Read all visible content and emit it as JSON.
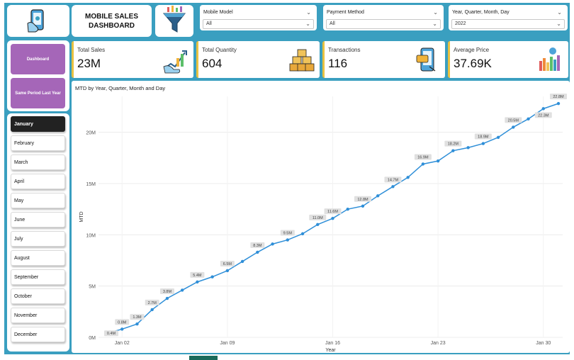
{
  "header": {
    "title": "MOBILE SALES DASHBOARD",
    "slicers": [
      {
        "label": "Mobile Model",
        "value": "All"
      },
      {
        "label": "Payment Method",
        "value": "All"
      },
      {
        "label": "Year, Quarter, Month, Day",
        "value": "2022"
      }
    ]
  },
  "kpis": [
    {
      "label": "Total Sales",
      "value": "23M",
      "icon": "sales-growth-icon"
    },
    {
      "label": "Total Quantity",
      "value": "604",
      "icon": "boxes-icon"
    },
    {
      "label": "Transactions",
      "value": "116",
      "icon": "phone-transaction-icon"
    },
    {
      "label": "Average Price",
      "value": "37.69K",
      "icon": "bar-chart-icon"
    }
  ],
  "nav": {
    "dashboard": "Dashboard",
    "same_period": "Same Period Last Year"
  },
  "months": [
    "January",
    "February",
    "March",
    "April",
    "May",
    "June",
    "July",
    "August",
    "September",
    "October",
    "November",
    "December"
  ],
  "active_month": "January",
  "colors": {
    "accent": "#3a9fc0",
    "nav": "#a566b8",
    "line": "#2f8fd8",
    "kpi_bar": "#e8c140"
  },
  "chart_data": {
    "type": "line",
    "title": "MTD by Year, Quarter, Month and Day",
    "xlabel": "Year",
    "ylabel": "MTD",
    "ylim": [
      0,
      23.5
    ],
    "yticks": [
      "0M",
      "5M",
      "10M",
      "15M",
      "20M"
    ],
    "xticks": [
      {
        "day": 2,
        "label": "Jan 02"
      },
      {
        "day": 9,
        "label": "Jan 09"
      },
      {
        "day": 16,
        "label": "Jan 16"
      },
      {
        "day": 23,
        "label": "Jan 23"
      },
      {
        "day": 30,
        "label": "Jan 30"
      }
    ],
    "series": [
      {
        "x": [
          1,
          2,
          3,
          4,
          5,
          6,
          7,
          8,
          9,
          10,
          11,
          12,
          13,
          14,
          15,
          16,
          17,
          18,
          19,
          20,
          21,
          22,
          23,
          24,
          25,
          26,
          27,
          28,
          29,
          30,
          31
        ],
        "values": [
          0.4,
          0.8,
          1.3,
          2.7,
          3.8,
          4.6,
          5.4,
          5.9,
          6.5,
          7.4,
          8.3,
          9.1,
          9.5,
          10.1,
          11.0,
          11.6,
          12.5,
          12.8,
          13.8,
          14.7,
          15.6,
          16.9,
          17.2,
          18.2,
          18.5,
          18.9,
          19.5,
          20.5,
          21.3,
          22.3,
          22.8
        ],
        "labels": {
          "1": "0.4M",
          "2": "0.8M",
          "3": "1.3M",
          "4": "2.7M",
          "5": "3.8M",
          "7": "5.4M",
          "9": "6.5M",
          "11": "8.3M",
          "13": "9.5M",
          "15": "11.0M",
          "16": "11.6M",
          "18": "12.8M",
          "20": "14.7M",
          "22": "16.9M",
          "24": "18.2M",
          "26": "18.9M",
          "28": "20.5M",
          "30": "22.3M",
          "31": "22.8M"
        }
      }
    ]
  }
}
